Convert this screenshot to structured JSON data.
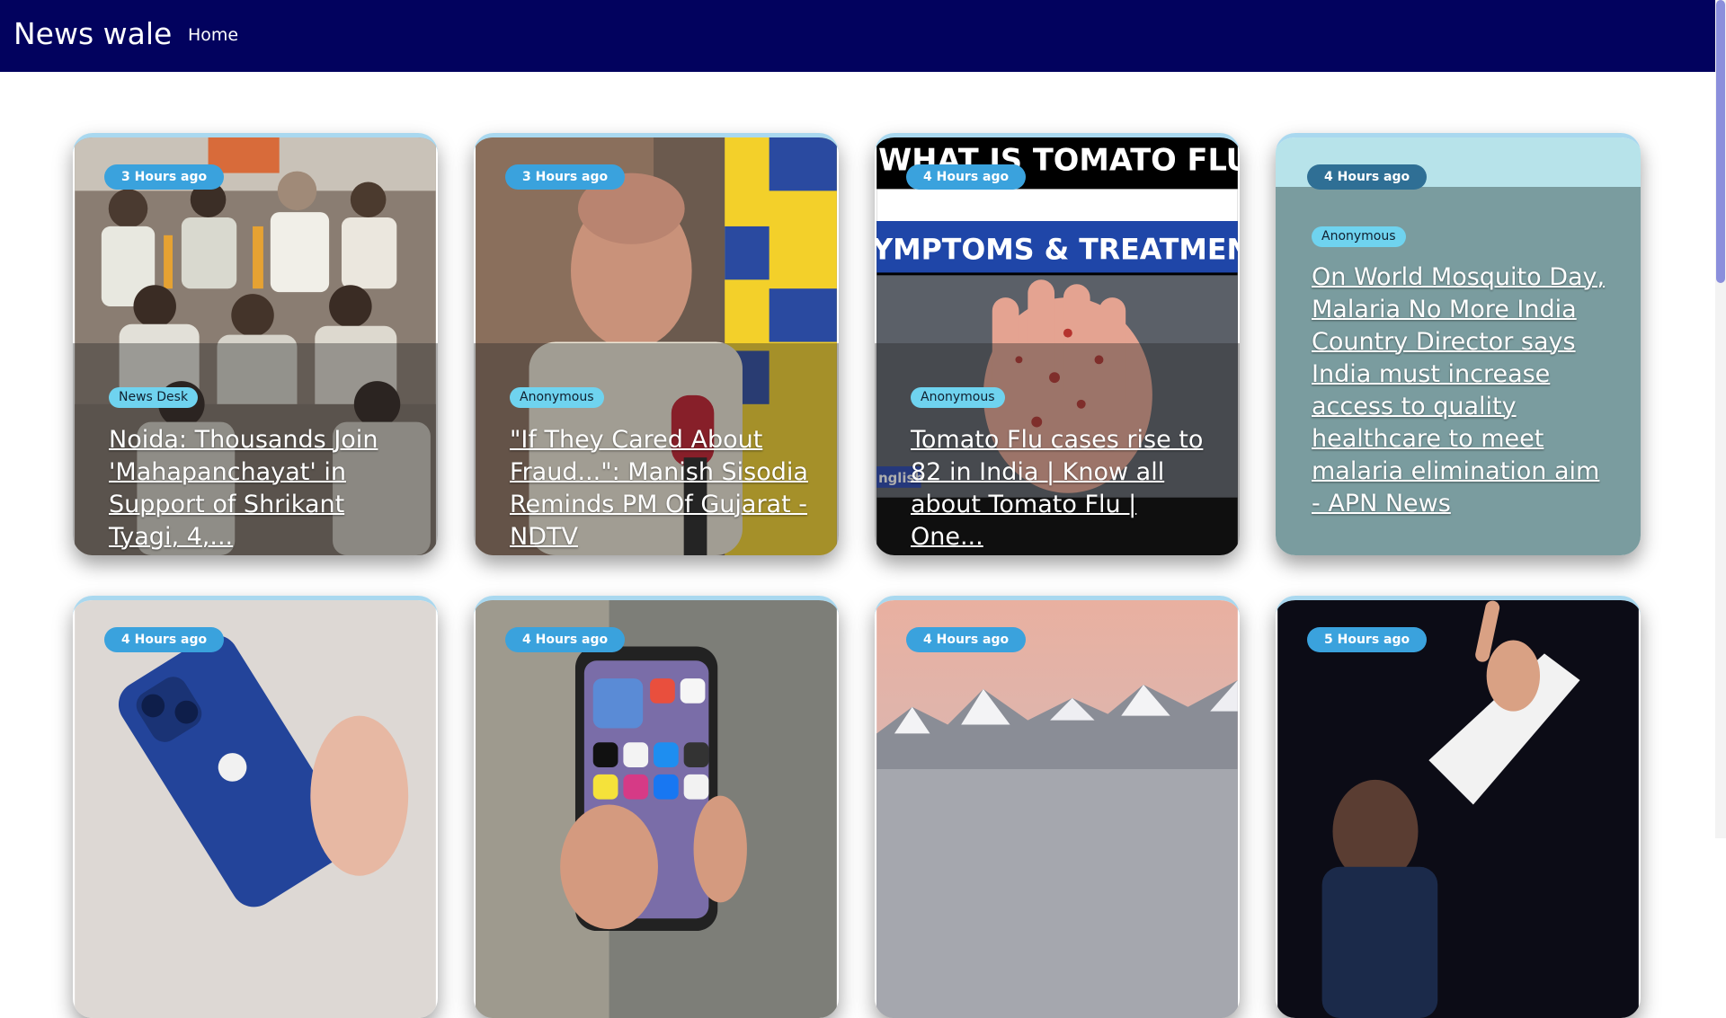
{
  "navbar": {
    "brand": "News wale",
    "home_link": "Home"
  },
  "cards": [
    {
      "time": "3 Hours ago",
      "author": "News Desk",
      "title": "Noida: Thousands Join 'Mahapanchayat' in Support of Shrikant Tyagi, 4,..."
    },
    {
      "time": "3 Hours ago",
      "author": "Anonymous",
      "title": "\"If They Cared About Fraud...\": Manish Sisodia Reminds PM Of Gujarat - NDTV"
    },
    {
      "time": "4 Hours ago",
      "author": "Anonymous",
      "title": "Tomato Flu cases rise to 82 in India | Know all about Tomato Flu | One...",
      "image_text": {
        "line1": "WHAT IS TOMATO FLU",
        "line2": "YMPTOMS & TREATMEN",
        "corner": "nglish"
      }
    },
    {
      "time": "4 Hours ago",
      "author": "Anonymous",
      "title": "On World Mosquito Day, Malaria No More India Country Director says India must increase access to quality healthcare to meet malaria elimination aim - APN News"
    },
    {
      "time": "4 Hours ago"
    },
    {
      "time": "4 Hours ago"
    },
    {
      "time": "4 Hours ago"
    },
    {
      "time": "5 Hours ago"
    }
  ],
  "colors": {
    "navbar": "#02025e",
    "badge": "#3aa2dd",
    "author_badge": "#6fd3ef"
  }
}
